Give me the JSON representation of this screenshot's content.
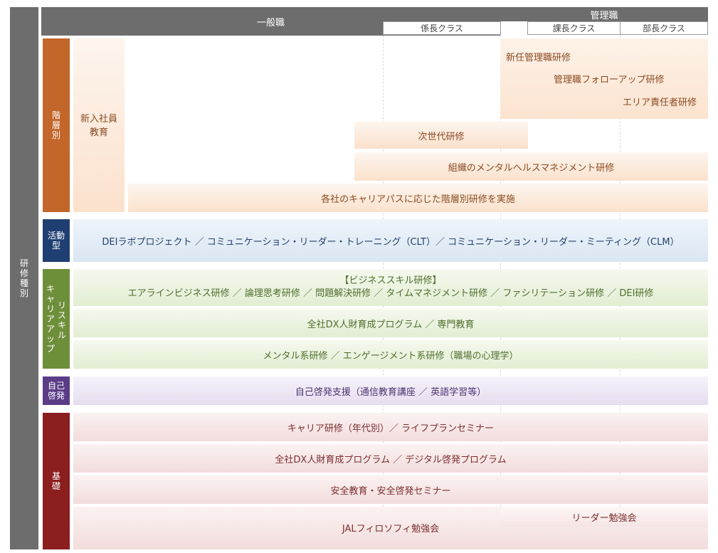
{
  "left_label": "研修種別",
  "header": {
    "general": "一般職",
    "management": "管理職",
    "subheaders": {
      "kakari": "係長クラス",
      "kacho": "課長クラス",
      "bucho": "部長クラス"
    }
  },
  "categories": {
    "kaisou": "階層別",
    "katsudou": "活動型",
    "career_a": "キャリアアップ",
    "career_b": "リスキル",
    "jiko": "自己啓発",
    "kiso": "基礎"
  },
  "kaisou": {
    "new_hire_line1": "新入社員",
    "new_hire_line2": "教育",
    "new_manager": "新任管理職研修",
    "manager_followup": "管理職フォローアップ研修",
    "area_lead": "エリア責任者研修",
    "next_gen": "次世代研修",
    "mental_health": "組織のメンタルヘルスマネジメント研修",
    "career_path": "各社のキャリアパスに応じた階層別研修を実施"
  },
  "katsudou": {
    "dei": "DEIラボプロジェクト ／ コミュニケーション・リーダー・トレーニング（CLT）／ コミュニケーション・リーダー・ミーティング（CLM）"
  },
  "career": {
    "business_skill_title": "【ビジネススキル研修】",
    "business_skill_items": "エアラインビジネス研修 ／ 論理思考研修 ／ 問題解決研修 ／ タイムマネジメント研修 ／ ファシリテーション研修 ／ DEI研修",
    "dx_program": "全社DX人財育成プログラム ／ 専門教育",
    "mental_engagement": "メンタル系研修 ／ エンゲージメント系研修（職場の心理学）"
  },
  "jiko": {
    "support": "自己啓発支援（通信教育講座 ／ 英語学習等）"
  },
  "kiso": {
    "career_seminar": "キャリア研修（年代別）／ ライフプランセミナー",
    "dx_digital": "全社DX人財育成プログラム ／ デジタル啓発プログラム",
    "safety": "安全教育・安全啓発セミナー",
    "leader_study": "リーダー勉強会",
    "philosophy": "JALフィロソフィ勉強会"
  },
  "colors": {
    "header_gray": "#6d6d6d",
    "kaisou": "#c2662a",
    "katsudou": "#1f3f73",
    "career": "#6e8f3a",
    "jiko": "#5b3c87",
    "kiso": "#8b1e1e"
  }
}
